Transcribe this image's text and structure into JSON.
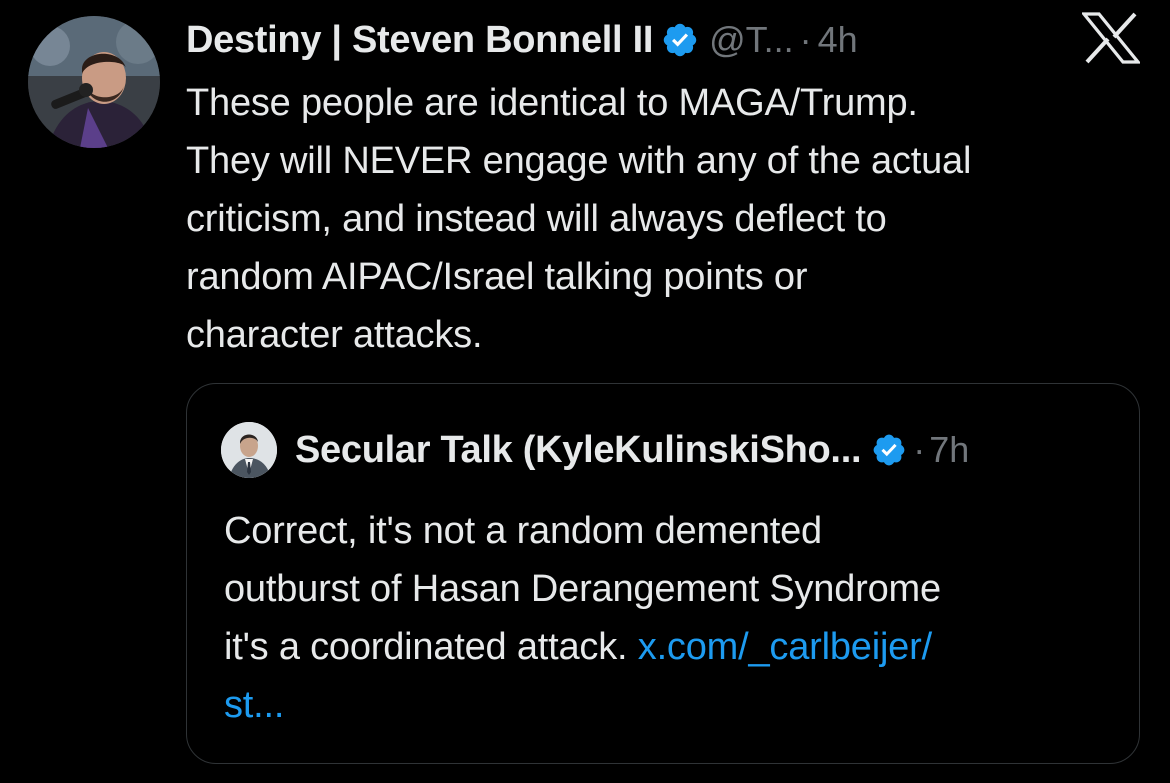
{
  "tweet": {
    "author": {
      "display_name": "Destiny | Steven Bonnell II",
      "handle": "@T...",
      "verified": true
    },
    "separator": "·",
    "time": "4h",
    "text_lines": [
      "These people are identical to MAGA/Trump.",
      "They will NEVER engage with any of the actual",
      "criticism, and instead will always deflect to",
      "random AIPAC/Israel talking points or",
      "character attacks."
    ],
    "close_icon": "x-logo-icon"
  },
  "quoted_tweet": {
    "author": {
      "display_name": "Secular Talk (KyleKulinskiSho...",
      "verified": true
    },
    "separator": "·",
    "time": "7h",
    "text_lines": [
      "Correct, it's not a random demented",
      "outburst of Hasan Derangement Syndrome",
      "it's a coordinated attack."
    ],
    "link_part1": "x.com/_carlbeijer/",
    "link_part2": "st..."
  },
  "colors": {
    "background": "#000000",
    "text": "#e7e9ea",
    "muted": "#71767b",
    "link": "#1d9bf0",
    "border": "#2f3336",
    "verified": "#1d9bf0"
  }
}
